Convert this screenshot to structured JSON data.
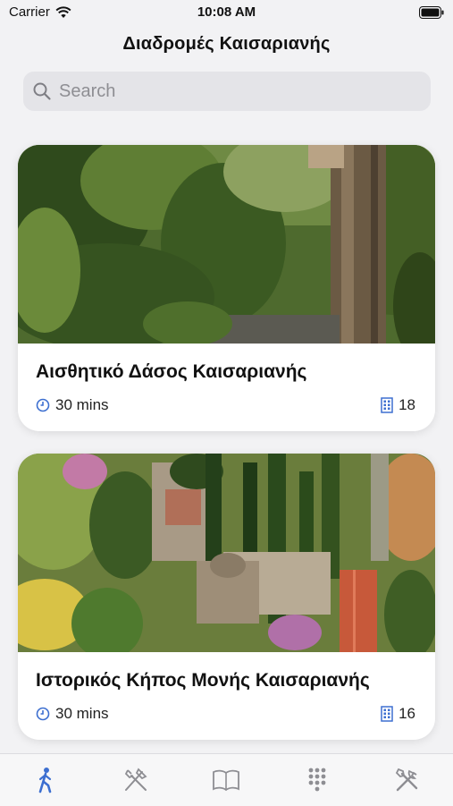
{
  "status_bar": {
    "carrier": "Carrier",
    "time": "10:08 AM"
  },
  "nav": {
    "title": "Διαδρομές Καισαριανής"
  },
  "search": {
    "placeholder": "Search"
  },
  "routes": [
    {
      "title": "Αισθητικό Δάσος Καισαριανής",
      "duration": "30 mins",
      "stops": "18"
    },
    {
      "title": "Ιστορικός Κήπος Μονής Καισαριανής",
      "duration": "30 mins",
      "stops": "16"
    }
  ],
  "tabs": [
    {
      "icon": "walking-person-icon",
      "active": true
    },
    {
      "icon": "fork-knife-icon",
      "active": false
    },
    {
      "icon": "book-icon",
      "active": false
    },
    {
      "icon": "grid-dots-icon",
      "active": false
    },
    {
      "icon": "tools-icon",
      "active": false
    }
  ],
  "colors": {
    "accent": "#3d6fd0",
    "inactive": "#8e8e93",
    "background": "#f2f2f4"
  }
}
